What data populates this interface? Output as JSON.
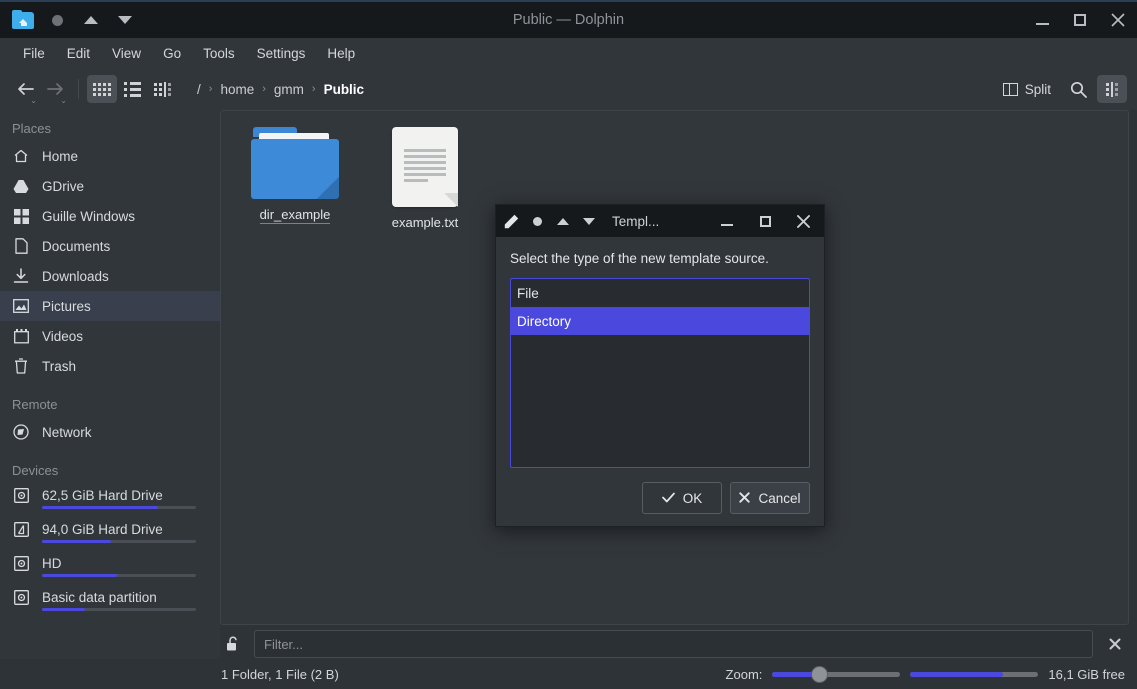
{
  "window": {
    "title": "Public — Dolphin",
    "titlebar_icons": [
      "folder-home-icon",
      "record-dot-icon",
      "triangle-up-icon",
      "triangle-down-icon"
    ],
    "controls": {
      "minimize": "—",
      "maximize": "□",
      "close": "✕"
    }
  },
  "menubar": {
    "items": [
      {
        "label": "File"
      },
      {
        "label": "Edit"
      },
      {
        "label": "View"
      },
      {
        "label": "Go"
      },
      {
        "label": "Tools"
      },
      {
        "label": "Settings"
      },
      {
        "label": "Help"
      }
    ]
  },
  "toolbar": {
    "back_label": "←",
    "forward_label": "→",
    "view_modes": [
      {
        "name": "icons-view",
        "active": true
      },
      {
        "name": "compact-view",
        "active": false
      },
      {
        "name": "details-view",
        "active": false
      }
    ],
    "split_label": "Split",
    "search_label": "Search",
    "menu_label": "Control menu"
  },
  "breadcrumb": {
    "root": "/",
    "separator": "›",
    "items": [
      "home",
      "gmm",
      "Public"
    ],
    "current": "Public"
  },
  "sidebar": {
    "sections": [
      {
        "title": "Places",
        "items": [
          {
            "label": "Home",
            "icon": "home-icon",
            "selected": false
          },
          {
            "label": "GDrive",
            "icon": "gdrive-icon",
            "selected": false
          },
          {
            "label": "Guille Windows",
            "icon": "windows-icon",
            "selected": false
          },
          {
            "label": "Documents",
            "icon": "document-icon",
            "selected": false
          },
          {
            "label": "Downloads",
            "icon": "download-icon",
            "selected": false
          },
          {
            "label": "Pictures",
            "icon": "picture-icon",
            "selected": true
          },
          {
            "label": "Videos",
            "icon": "video-icon",
            "selected": false
          },
          {
            "label": "Trash",
            "icon": "trash-icon",
            "selected": false
          }
        ]
      },
      {
        "title": "Remote",
        "items": [
          {
            "label": "Network",
            "icon": "network-icon",
            "selected": false
          }
        ]
      },
      {
        "title": "Devices",
        "items": [
          {
            "label": "62,5 GiB Hard Drive",
            "icon": "disk-icon",
            "capacity_percent": 75
          },
          {
            "label": "94,0 GiB Hard Drive",
            "icon": "disk-windows-icon",
            "capacity_percent": 45
          },
          {
            "label": "HD",
            "icon": "disk-icon",
            "capacity_percent": 49
          },
          {
            "label": "Basic data partition",
            "icon": "disk-icon",
            "capacity_percent": 28
          }
        ]
      }
    ]
  },
  "files": [
    {
      "name": "dir_example",
      "type": "folder"
    },
    {
      "name": "example.txt",
      "type": "text-file"
    }
  ],
  "filter": {
    "placeholder": "Filter...",
    "value": "",
    "lock_icon": "unlock-icon",
    "clear_icon": "close-icon"
  },
  "status": {
    "summary": "1 Folder, 1 File (2 B)",
    "zoom_label": "Zoom:",
    "zoom_percent": 30,
    "free_space": "16,1 GiB free",
    "free_percent": 72
  },
  "dialog": {
    "title": "Templ...",
    "titlebar_icons": [
      "pencil-icon",
      "record-dot-icon",
      "triangle-up-icon",
      "triangle-down-icon"
    ],
    "prompt": "Select the type of the new template source.",
    "options": [
      {
        "label": "File",
        "selected": false
      },
      {
        "label": "Directory",
        "selected": true
      }
    ],
    "ok_label": "OK",
    "cancel_label": "Cancel",
    "controls": {
      "minimize": "—",
      "maximize": "□",
      "close": "✕"
    }
  },
  "colors": {
    "accent": "#4a48dd",
    "titlebar_bg": "#16191c",
    "window_bg": "#31363b",
    "folder_blue": "#3d8bd8"
  }
}
